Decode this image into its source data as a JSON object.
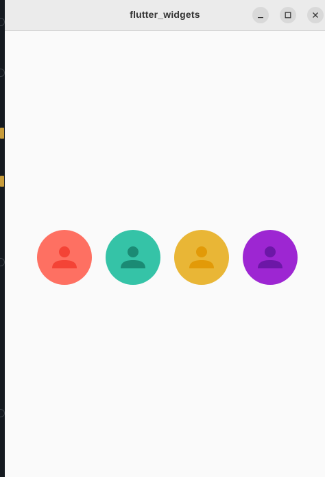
{
  "window": {
    "title": "flutter_widgets"
  },
  "left_strip": {
    "badges": [
      "1",
      "1"
    ]
  },
  "avatars": [
    {
      "icon": "person-icon",
      "bg": "#fe7062",
      "fg": "#f44336"
    },
    {
      "icon": "person-icon",
      "bg": "#35c3a7",
      "fg": "#1b8a74"
    },
    {
      "icon": "person-icon",
      "bg": "#e9b636",
      "fg": "#e29a08"
    },
    {
      "icon": "person-icon",
      "bg": "#9d26d2",
      "fg": "#6c17a7"
    }
  ]
}
